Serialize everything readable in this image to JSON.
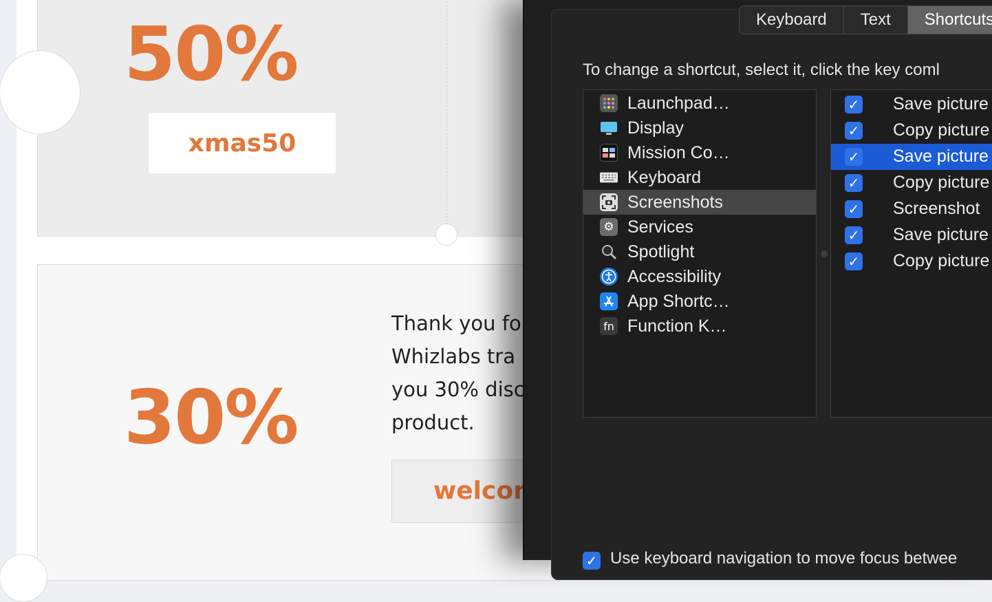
{
  "webpage": {
    "coupon_1": {
      "percent": "50%",
      "code": "xmas50"
    },
    "coupon_2": {
      "percent": "30%",
      "lines": [
        "Thank you fo",
        "Whizlabs tra",
        "you 30% disc",
        "product."
      ],
      "code": "welcor"
    },
    "accent_color": "#e2783b"
  },
  "sysprefs": {
    "tabs": [
      {
        "label": "Keyboard",
        "active": false
      },
      {
        "label": "Text",
        "active": false
      },
      {
        "label": "Shortcuts",
        "active": true
      }
    ],
    "instruction": "To change a shortcut, select it, click the key coml",
    "categories": [
      {
        "label": "Launchpad…",
        "icon": "launchpad-icon"
      },
      {
        "label": "Display",
        "icon": "display-icon"
      },
      {
        "label": "Mission Co…",
        "icon": "mission-control-icon"
      },
      {
        "label": "Keyboard",
        "icon": "keyboard-icon"
      },
      {
        "label": "Screenshots",
        "icon": "screenshot-icon",
        "selected": true
      },
      {
        "label": "Services",
        "icon": "gear-icon"
      },
      {
        "label": "Spotlight",
        "icon": "magnifier-icon"
      },
      {
        "label": "Accessibility",
        "icon": "accessibility-icon"
      },
      {
        "label": "App Shortc…",
        "icon": "app-store-icon"
      },
      {
        "label": "Function K…",
        "icon": "fn-key-icon"
      }
    ],
    "shortcuts": [
      {
        "label": "Save picture",
        "checked": true
      },
      {
        "label": "Copy picture",
        "checked": true
      },
      {
        "label": "Save picture",
        "checked": true,
        "selected": true
      },
      {
        "label": "Copy picture",
        "checked": true
      },
      {
        "label": "Screenshot",
        "checked": true
      },
      {
        "label": "Save picture",
        "checked": true
      },
      {
        "label": "Copy picture",
        "checked": true
      }
    ],
    "bottom_checkbox_label": "Use keyboard navigation to move focus betwee",
    "checkmark": "✓"
  }
}
